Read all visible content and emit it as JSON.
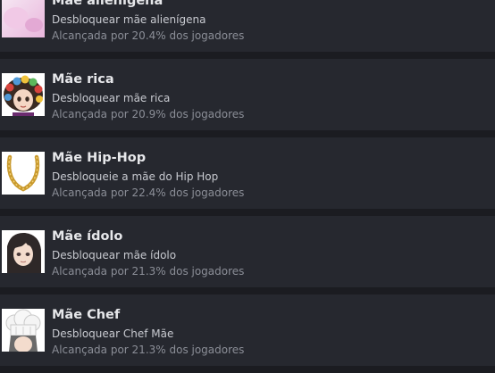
{
  "achievements": [
    {
      "title": "Mãe alienígena",
      "description": "Desbloquear mãe alienígena",
      "unlock_rate": "Alcançada por 20.4% dos jogadores",
      "icon": "alien-mom-icon"
    },
    {
      "title": "Mãe rica",
      "description": "Desbloquear mãe rica",
      "unlock_rate": "Alcançada por 20.9% dos jogadores",
      "icon": "rich-mom-icon"
    },
    {
      "title": "Mãe Hip-Hop",
      "description": "Desbloqueie a mãe do Hip Hop",
      "unlock_rate": "Alcançada por 22.4% dos jogadores",
      "icon": "gold-chain-icon"
    },
    {
      "title": "Mãe ídolo",
      "description": "Desbloquear mãe ídolo",
      "unlock_rate": "Alcançada por 21.3% dos jogadores",
      "icon": "idol-mom-icon"
    },
    {
      "title": "Mãe Chef",
      "description": "Desbloquear Chef Mãe",
      "unlock_rate": "Alcançada por 21.3% dos jogadores",
      "icon": "chef-hat-icon"
    }
  ],
  "colors": {
    "background": "#1b1c21",
    "row": "#26282f",
    "title": "#e6e7ea",
    "description": "#c8cad0",
    "unlock_rate": "#8b8e97"
  }
}
